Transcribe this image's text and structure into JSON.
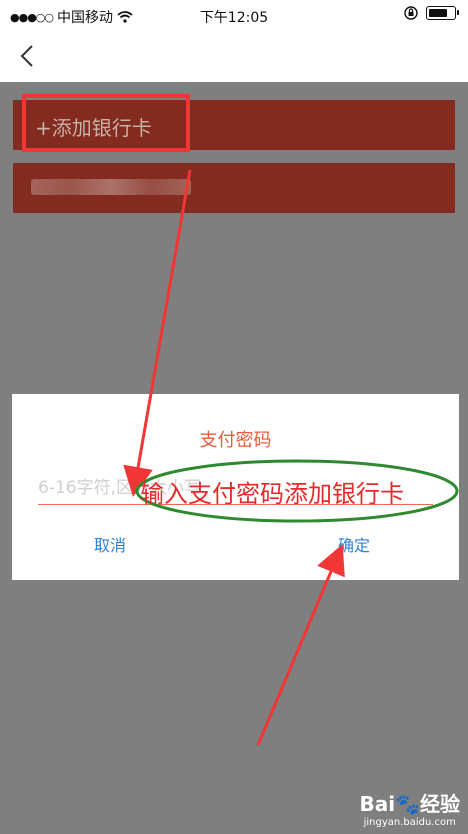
{
  "status_bar": {
    "carrier": "中国移动",
    "time": "下午12:05"
  },
  "bank_list": {
    "add_card_label": "+添加银行卡"
  },
  "dialog": {
    "title": "支付密码",
    "password_placeholder": "6-16字符,区分大小写",
    "cancel_label": "取消",
    "confirm_label": "确定"
  },
  "annotation": {
    "text": "输入支付密码添加银行卡",
    "color": "#e52a2a",
    "ellipse_color": "#2f8a2f"
  },
  "watermark": {
    "logo": "Bai🐾经验",
    "url": "jingyan.baidu.com"
  },
  "colors": {
    "bank_row": "#822b1e",
    "overlay": "#7f7f7f",
    "accent": "#ef5a3a",
    "button_blue": "#2a84d8"
  }
}
